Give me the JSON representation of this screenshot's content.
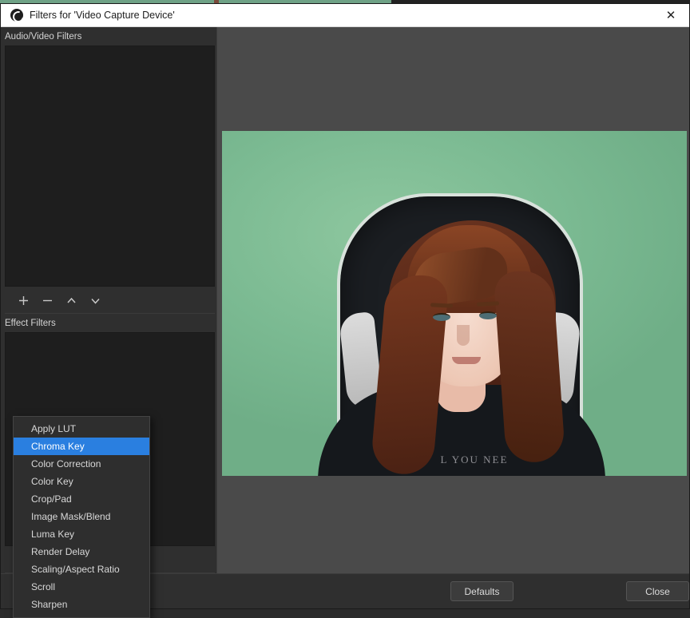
{
  "window": {
    "title": "Filters for 'Video Capture Device'",
    "logo_icon": "obs-logo-icon",
    "close_icon": "✕"
  },
  "left_pane": {
    "av_filters_label": "Audio/Video Filters",
    "effect_filters_label": "Effect Filters",
    "toolbar": {
      "add_icon": "plus-icon",
      "remove_icon": "minus-icon",
      "move_up_icon": "chevron-up-icon",
      "move_down_icon": "chevron-down-icon"
    },
    "av_filters_items": [],
    "effect_filters_items": []
  },
  "context_menu": {
    "selected": "Chroma Key",
    "items": [
      {
        "label": "Apply LUT",
        "selected": false
      },
      {
        "label": "Chroma Key",
        "selected": true
      },
      {
        "label": "Color Correction",
        "selected": false
      },
      {
        "label": "Color Key",
        "selected": false
      },
      {
        "label": "Crop/Pad",
        "selected": false
      },
      {
        "label": "Image Mask/Blend",
        "selected": false
      },
      {
        "label": "Luma Key",
        "selected": false
      },
      {
        "label": "Render Delay",
        "selected": false
      },
      {
        "label": "Scaling/Aspect Ratio",
        "selected": false
      },
      {
        "label": "Scroll",
        "selected": false
      },
      {
        "label": "Sharpen",
        "selected": false
      }
    ]
  },
  "preview": {
    "shirt_text": "L YOU NEE",
    "background_color": "#4a4a4a",
    "green_screen_color": "#7bba92"
  },
  "footer": {
    "defaults_label": "Defaults",
    "close_label": "Close"
  },
  "colors": {
    "accent": "#2a7fe0",
    "dialog_bg": "#2f2f2f",
    "list_bg": "#1e1e1e",
    "titlebar_bg": "#ffffff",
    "meter_green": "#2f8f2f",
    "meter_yellow": "#8a7a1e",
    "meter_red": "#8a2020"
  }
}
